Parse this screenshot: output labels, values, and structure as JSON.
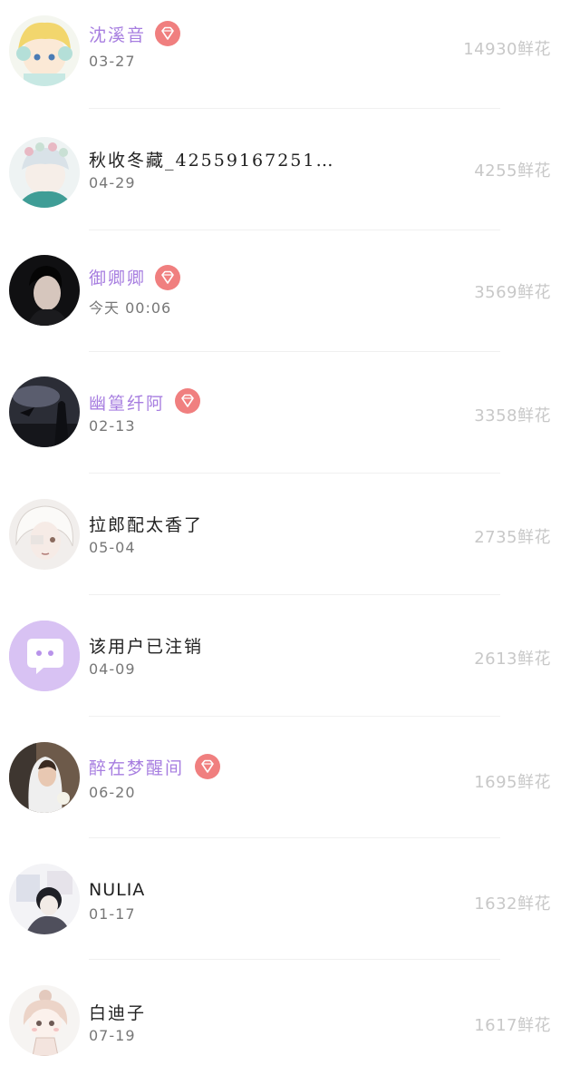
{
  "users": [
    {
      "name": "沈溪音",
      "date": "03-27",
      "flowers": "14930鲜花",
      "vip": true,
      "avatar_icon": "anime-blonde-avatar"
    },
    {
      "name": "秋收冬藏_42559167251…",
      "date": "04-29",
      "flowers": "4255鲜花",
      "vip": false,
      "avatar_icon": "anime-flower-crown-avatar"
    },
    {
      "name": "御卿卿",
      "date": "今天 00:06",
      "flowers": "3569鲜花",
      "vip": true,
      "avatar_icon": "dark-portrait-avatar"
    },
    {
      "name": "幽篁纤阿",
      "date": "02-13",
      "flowers": "3358鲜花",
      "vip": true,
      "avatar_icon": "dark-scene-avatar"
    },
    {
      "name": "拉郎配太香了",
      "date": "05-04",
      "flowers": "2735鲜花",
      "vip": false,
      "avatar_icon": "white-hair-sketch-avatar"
    },
    {
      "name": "该用户已注销",
      "date": "04-09",
      "flowers": "2613鲜花",
      "vip": false,
      "avatar_icon": "deleted-user-chat-avatar"
    },
    {
      "name": "醉在梦醒间",
      "date": "06-20",
      "flowers": "1695鲜花",
      "vip": true,
      "avatar_icon": "bride-photo-avatar"
    },
    {
      "name": "NULIA",
      "date": "01-17",
      "flowers": "1632鲜花",
      "vip": false,
      "avatar_icon": "anime-collage-avatar"
    },
    {
      "name": "白迪子",
      "date": "07-19",
      "flowers": "1617鲜花",
      "vip": false,
      "avatar_icon": "chibi-girl-avatar"
    }
  ],
  "colors": {
    "vip_name": "#a77ee0",
    "vip_badge": "#f07f7f",
    "flowers_text": "#c8c8c8",
    "deleted_avatar": "#d8c2f3"
  }
}
